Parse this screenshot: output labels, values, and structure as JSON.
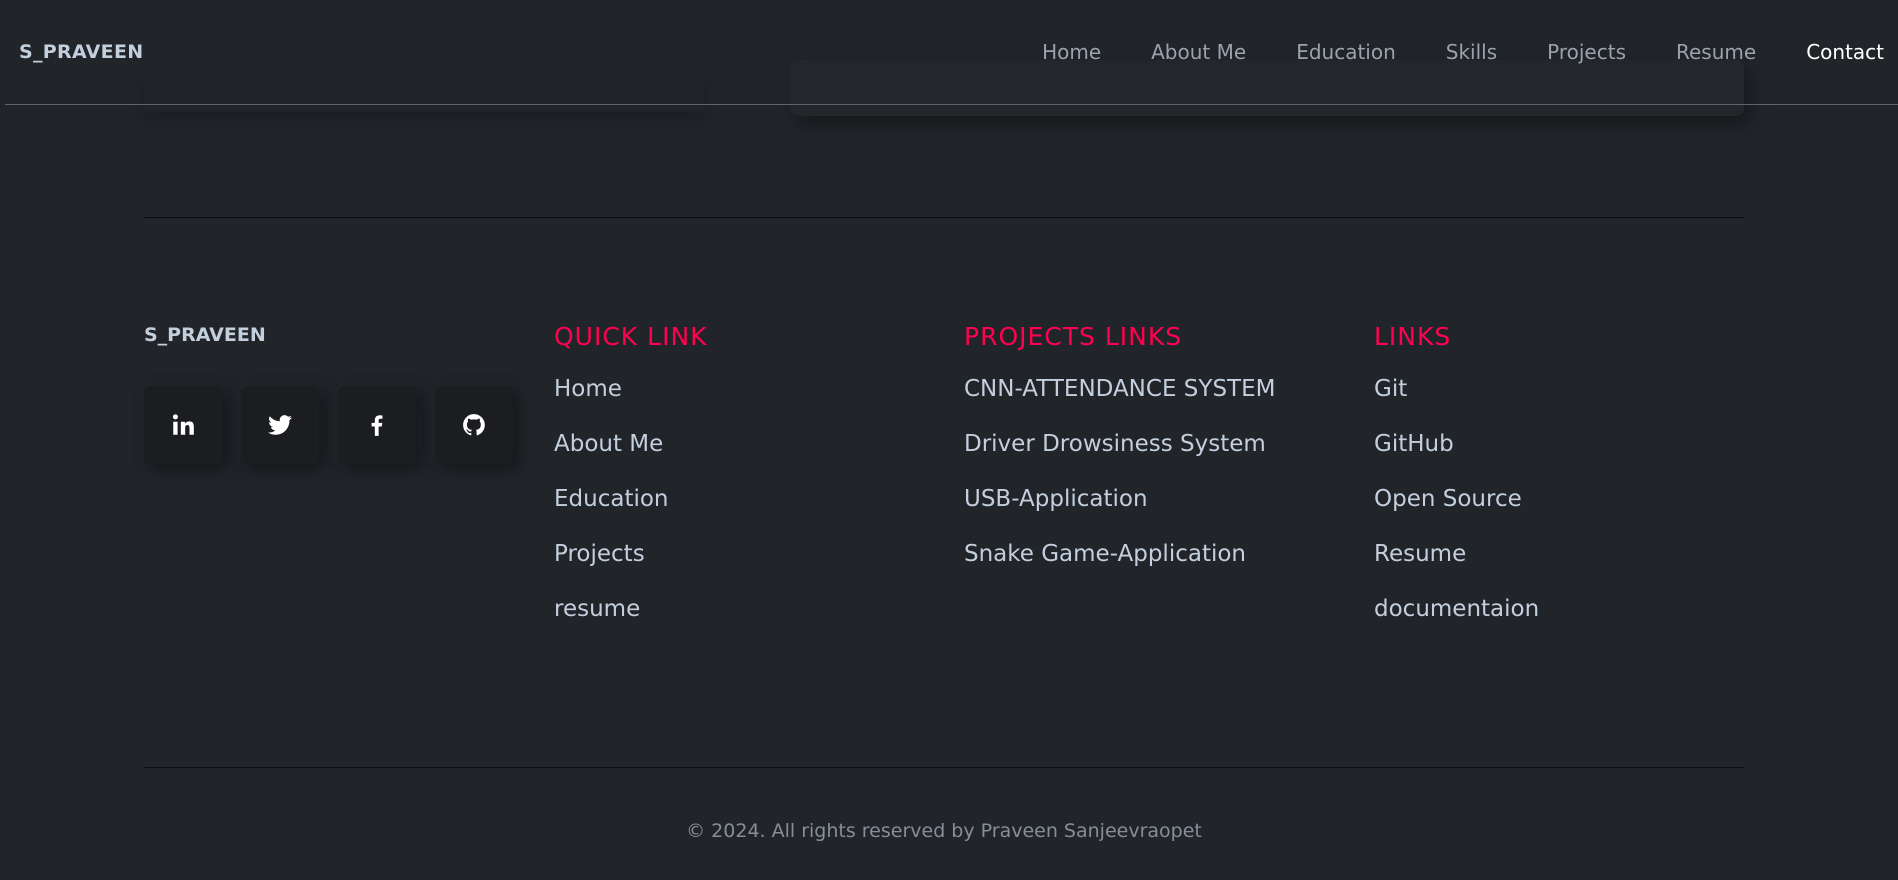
{
  "nav": {
    "brand": "S_PRAVEEN",
    "items": [
      {
        "label": "Home"
      },
      {
        "label": "About Me"
      },
      {
        "label": "Education"
      },
      {
        "label": "Skills"
      },
      {
        "label": "Projects"
      },
      {
        "label": "Resume"
      },
      {
        "label": "Contact"
      }
    ],
    "active": "Contact"
  },
  "footer": {
    "brand": "S_PRAVEEN",
    "social": [
      {
        "icon": "linkedin-icon"
      },
      {
        "icon": "twitter-icon"
      },
      {
        "icon": "facebook-icon"
      },
      {
        "icon": "github-icon"
      }
    ],
    "quick_links": {
      "title": "QUICK LINK",
      "items": [
        "Home",
        "About Me",
        "Education",
        "Projects",
        "resume"
      ]
    },
    "project_links": {
      "title": "PROJECTS LINKS",
      "items": [
        "CNN-ATTENDANCE SYSTEM",
        "Driver Drowsiness System",
        "USB-Application",
        "Snake Game-Application"
      ]
    },
    "links": {
      "title": "LINKS",
      "items": [
        "Git",
        "GitHub",
        "Open Source",
        "Resume",
        "documentaion"
      ]
    },
    "copyright": "© 2024. All rights reserved by Praveen Sanjeevraopet"
  },
  "colors": {
    "background": "#212429",
    "accent": "#ff014f",
    "text": "#c4cfde",
    "muted": "#878e99"
  }
}
